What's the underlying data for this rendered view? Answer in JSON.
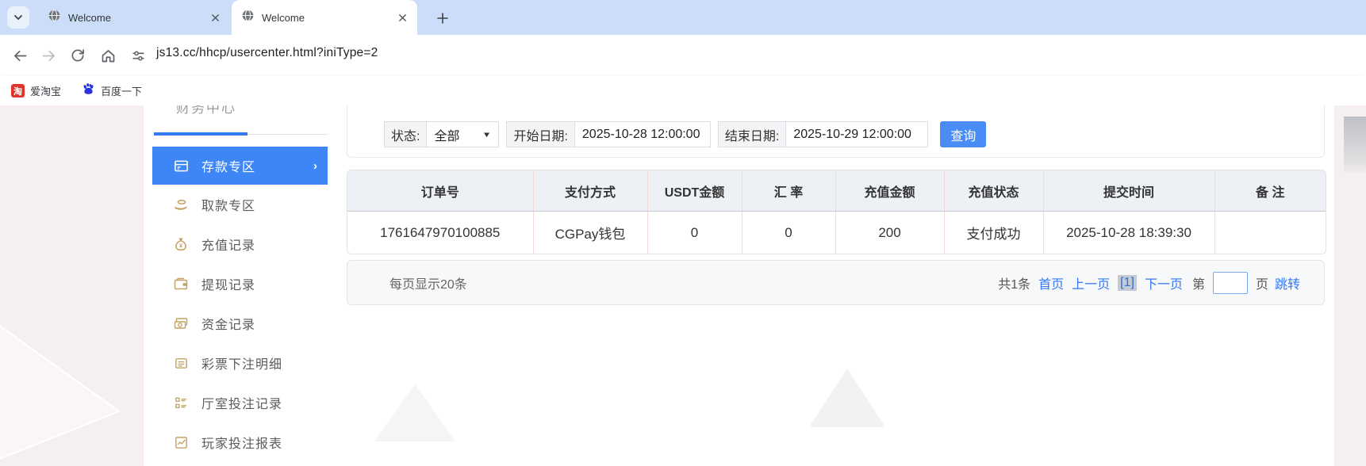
{
  "browser": {
    "tabs": [
      {
        "title": "Welcome"
      },
      {
        "title": "Welcome"
      }
    ],
    "url": "js13.cc/hhcp/usercenter.html?iniType=2",
    "bookmarks": [
      {
        "label": "爱淘宝",
        "icon": "taobao-icon",
        "icon_glyph": "淘"
      },
      {
        "label": "百度一下",
        "icon": "baidu-paw-icon"
      }
    ]
  },
  "sidebar": {
    "section_title": "财务中心",
    "items": [
      {
        "label": "存款专区",
        "icon": "deposit-card-icon",
        "active": true
      },
      {
        "label": "取款专区",
        "icon": "withdraw-hand-icon",
        "active": false
      },
      {
        "label": "充值记录",
        "icon": "moneybag-icon",
        "active": false
      },
      {
        "label": "提现记录",
        "icon": "wallet-icon",
        "active": false
      },
      {
        "label": "资金记录",
        "icon": "funds-icon",
        "active": false
      },
      {
        "label": "彩票下注明细",
        "icon": "lottery-list-icon",
        "active": false
      },
      {
        "label": "厅室投注记录",
        "icon": "hall-bet-icon",
        "active": false
      },
      {
        "label": "玩家投注报表",
        "icon": "report-chart-icon",
        "active": false
      }
    ],
    "active_chevron": "›"
  },
  "filters": {
    "status_label": "状态:",
    "status_value": "全部",
    "start_label": "开始日期:",
    "start_value": "2025-10-28 12:00:00",
    "end_label": "结束日期:",
    "end_value": "2025-10-29 12:00:00",
    "search_button": "查询"
  },
  "table": {
    "columns": [
      "订单号",
      "支付方式",
      "USDT金额",
      "汇 率",
      "充值金额",
      "充值状态",
      "提交时间",
      "备 注"
    ],
    "rows": [
      [
        "1761647970100885",
        "CGPay钱包",
        "0",
        "0",
        "200",
        "支付成功",
        "2025-10-28 18:39:30",
        ""
      ]
    ]
  },
  "pagination": {
    "page_size_text": "每页显示20条",
    "total_text": "共1条",
    "first_label": "首页",
    "prev_label": "上一页",
    "current_label": "[1]",
    "next_label": "下一页",
    "jump_prefix": "第",
    "jump_value": "",
    "jump_suffix": "页",
    "jump_button": "跳转"
  },
  "colors": {
    "tabstrip": "#cbddf8",
    "active_menu_blue": "#3e86f5",
    "query_button_blue": "#4a8cf5",
    "link_blue": "#3478f6",
    "sidebar_icon_gold": "#c3a264",
    "table_header_bg": "#edf0f5",
    "table_divider_pink": "#efd8d8",
    "page_side_bg": "#f6eff0",
    "pager_bg": "#f7f8fa",
    "current_page_badge_bg": "#c6cad2",
    "taobao_red": "#e0332c",
    "baidu_blue": "#2932e1"
  }
}
